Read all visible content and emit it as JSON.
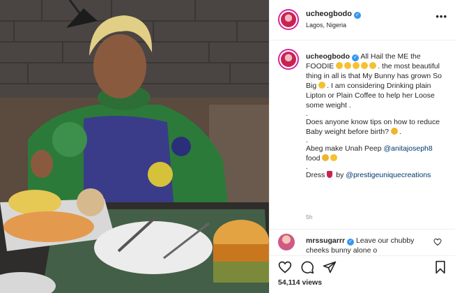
{
  "post": {
    "username": "ucheogbodo",
    "location": "Lagos, Nigeria",
    "more_label": "•••"
  },
  "caption": {
    "username": "ucheogbodo",
    "line1": "All Hail the ME the FOODIE",
    "line1b": ". the most beautiful thing in all is that My Bunny has grown So Big",
    "line1c": ". I am considering Drinking plain Lipton or Plain Coffee to help her Loose some weight .",
    "dot": ".",
    "line2": "Does anyone know tips on how to reduce Baby weight before birth?",
    "line2b": ".",
    "line3": "Abeg make Unah Peep",
    "mention1": "@anitajoseph8",
    "line3b": "food",
    "line4": "Dress",
    "line4b": "by",
    "mention2": "@prestigeuniquecreations",
    "time": "5h"
  },
  "comment": {
    "username": "mrssugarrr",
    "text": "Leave our chubby cheeks bunny alone o"
  },
  "actions": {
    "like_icon": "heart-icon",
    "comment_icon": "comment-icon",
    "share_icon": "send-icon",
    "save_icon": "bookmark-icon"
  },
  "likes": {
    "views": "54,114 views"
  },
  "colors": {
    "verified": "#3897f0",
    "mention": "#00376b",
    "muted": "#8e8e8e",
    "border": "#efefef"
  }
}
